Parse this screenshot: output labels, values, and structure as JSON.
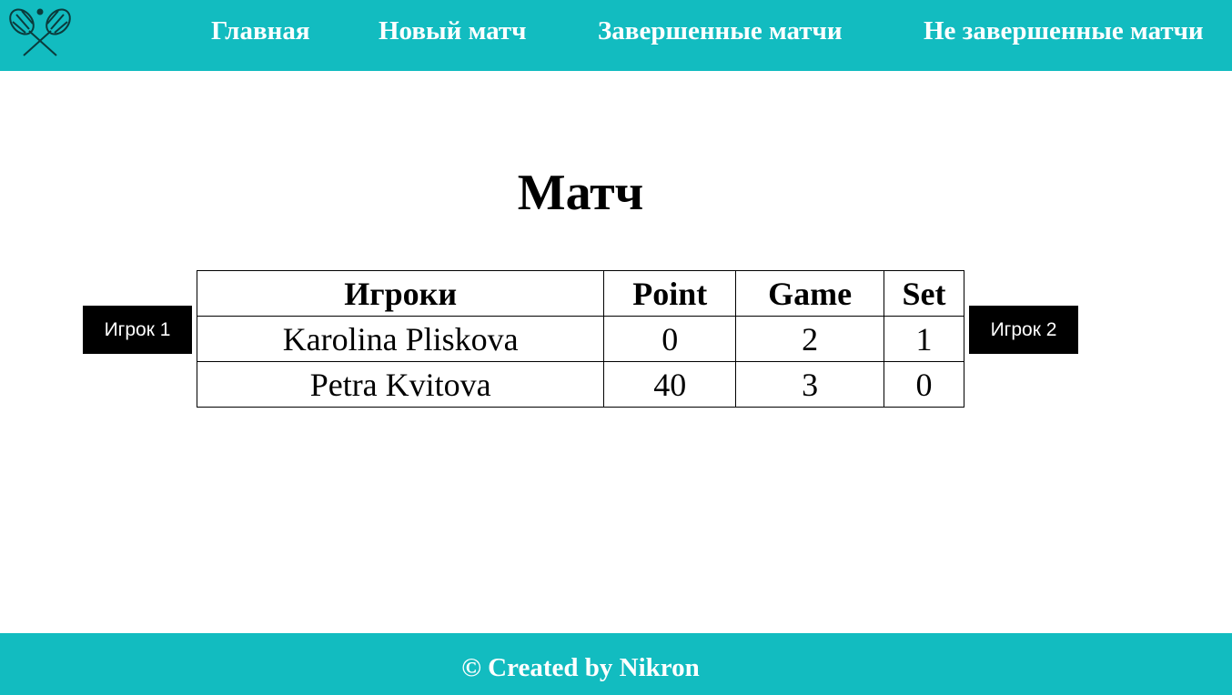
{
  "nav": {
    "logo_icon": "tennis-rackets-icon",
    "items": [
      {
        "label": "Главная"
      },
      {
        "label": "Новый матч"
      },
      {
        "label": "Завершенные матчи"
      },
      {
        "label": "Не завершенные матчи"
      }
    ]
  },
  "main": {
    "title": "Матч",
    "player1_button": "Игрок 1",
    "player2_button": "Игрок 2",
    "table": {
      "headers": [
        "Игроки",
        "Point",
        "Game",
        "Set"
      ],
      "rows": [
        [
          "Karolina Pliskova",
          "0",
          "2",
          "1"
        ],
        [
          "Petra Kvitova",
          "40",
          "3",
          "0"
        ]
      ]
    }
  },
  "footer": {
    "text": "© Created by Nikron"
  },
  "colors": {
    "accent": "#12bcc0",
    "button_bg": "#000000",
    "button_text": "#ffffff"
  }
}
